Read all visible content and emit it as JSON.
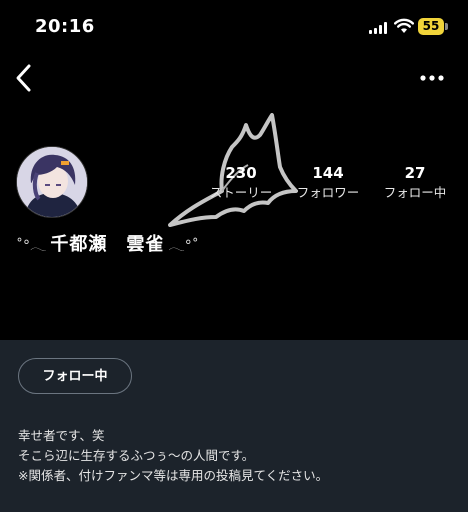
{
  "status_bar": {
    "time": "20:16",
    "battery": "55",
    "battery_color": "#f1d43a",
    "signal_icon": "cellular-signal-icon",
    "wifi_icon": "wifi-icon"
  },
  "nav": {
    "back_icon": "back-chevron-icon",
    "more_icon": "more-horizontal-icon"
  },
  "profile": {
    "name_prefix": "˚°𓂃",
    "name": "千都瀬　雲雀",
    "name_suffix": "𓂃°˚",
    "stats": [
      {
        "value": "230",
        "label": "ストーリー"
      },
      {
        "value": "144",
        "label": "フォロワー"
      },
      {
        "value": "27",
        "label": "フォロー中"
      }
    ]
  },
  "actions": {
    "follow_label": "フォロー中"
  },
  "bio": {
    "lines": [
      "幸せ者です、笑",
      "そこら辺に生存するふつぅ〜の人間です。",
      "※関係者、付けファンマ等は専用の投稿見てください。"
    ]
  },
  "colors": {
    "background": "#000000",
    "panel": "#1c232b",
    "button_border": "#6b7580"
  }
}
